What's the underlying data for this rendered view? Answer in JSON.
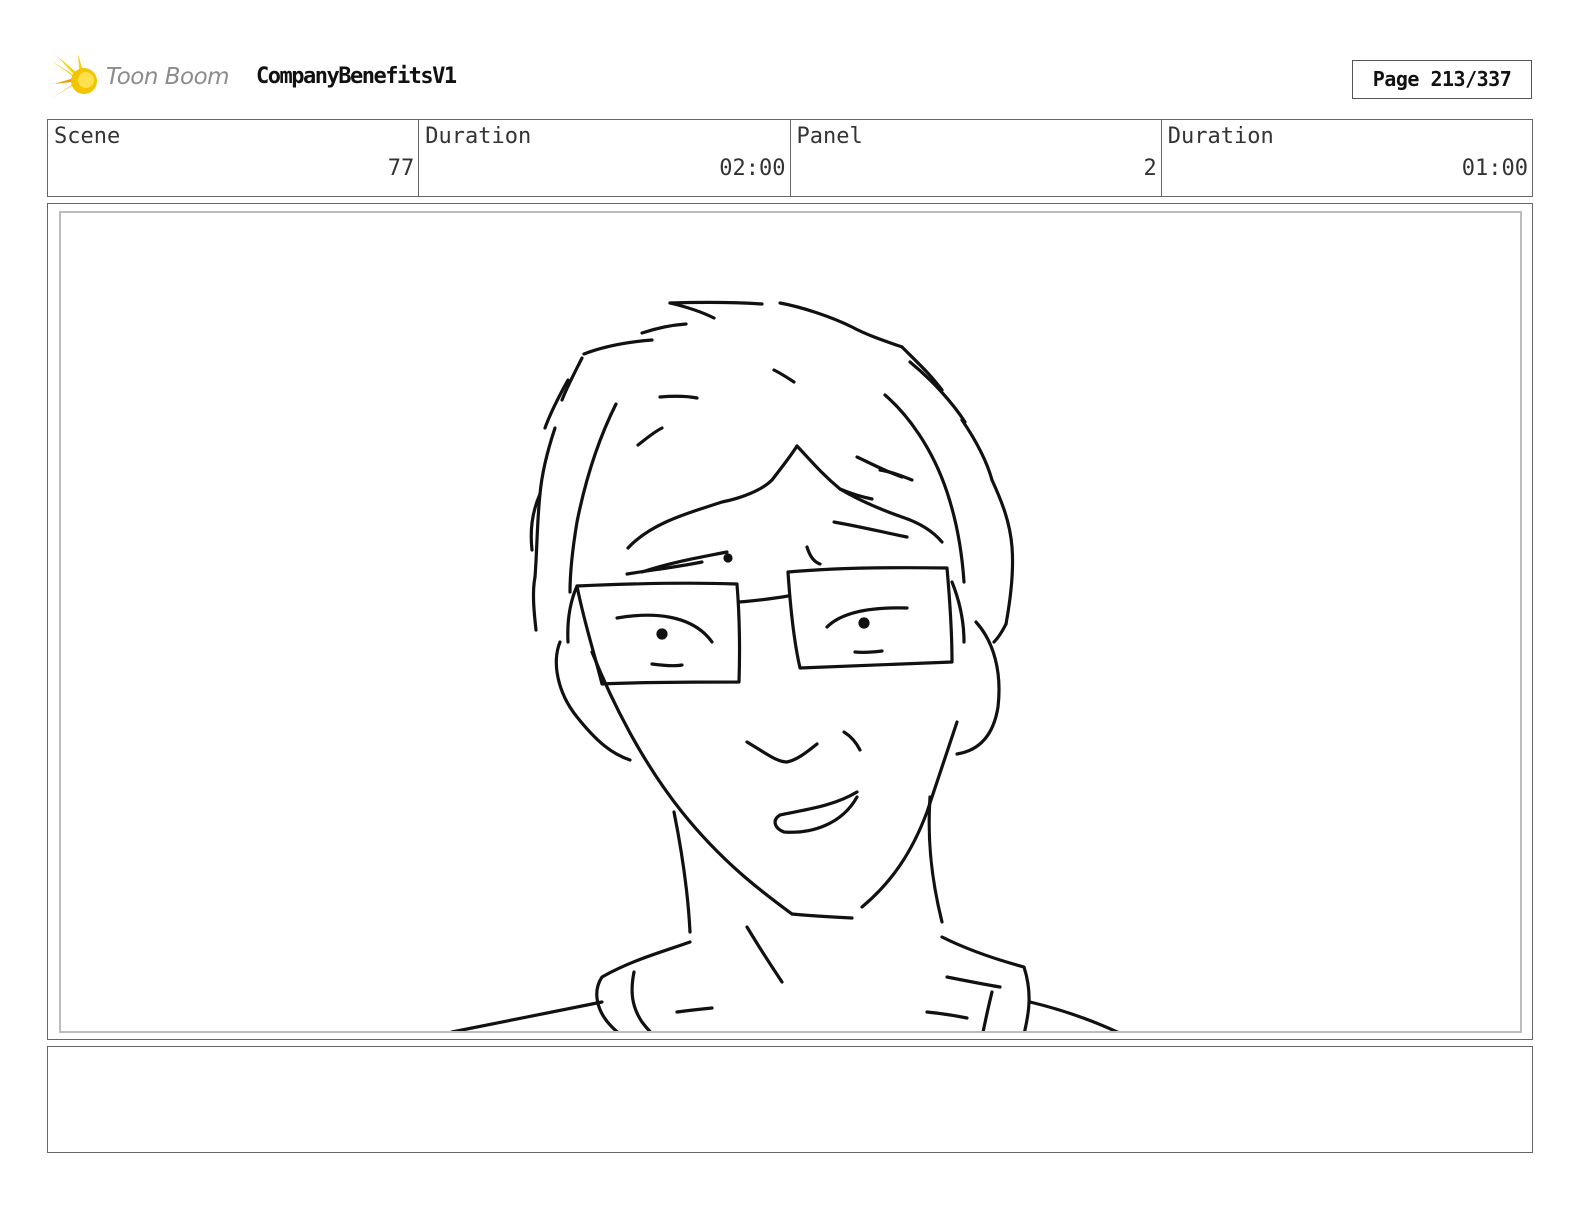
{
  "header": {
    "logo_text": "Toon Boom",
    "project_title": "CompanyBenefitsV1",
    "page_label": "Page 213/337"
  },
  "info": {
    "scene_label": "Scene",
    "scene_value": "77",
    "scene_duration_label": "Duration",
    "scene_duration_value": "02:00",
    "panel_label": "Panel",
    "panel_value": "2",
    "panel_duration_label": "Duration",
    "panel_duration_value": "01:00"
  },
  "panel": {
    "image": "sketch-man-with-glasses"
  },
  "notes": {
    "text": ""
  },
  "colors": {
    "logo_yellow": "#f5c400",
    "logo_orange": "#f39a00",
    "border": "#666666",
    "inner_border": "#bdbdbd"
  }
}
